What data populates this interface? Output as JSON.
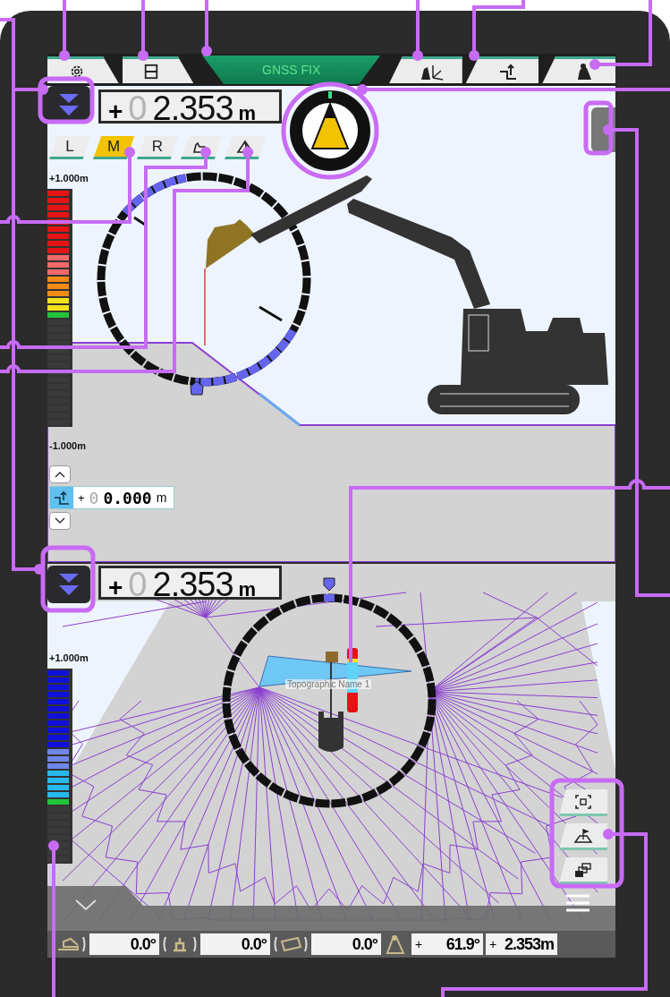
{
  "top_bar": {
    "status": "GNSS FIX"
  },
  "upper_view": {
    "depth": {
      "sign": "+",
      "ghost_digit": "0",
      "value": "2.353",
      "unit": "m"
    },
    "side_tabs": [
      {
        "label": "L",
        "selected": false
      },
      {
        "label": "M",
        "selected": true
      },
      {
        "label": "R",
        "selected": false
      }
    ],
    "scale": {
      "top": "+1.000m",
      "bottom": "-1.000m"
    },
    "offset": {
      "sign": "+",
      "ghost_digit": "0",
      "value": "0.000",
      "unit": "m"
    }
  },
  "lower_view": {
    "depth": {
      "sign": "+",
      "ghost_digit": "0",
      "value": "2.353",
      "unit": "m"
    },
    "scale": {
      "top": "+1.000m"
    },
    "surface_label": "Topographic Name 1"
  },
  "bottom_bar": {
    "angles": [
      {
        "kind": "swing",
        "value": "0.0°"
      },
      {
        "kind": "pitch",
        "value": "0.0°"
      },
      {
        "kind": "tilt",
        "value": "0.0°"
      }
    ],
    "boom": {
      "sign": "+",
      "value": "61.9°"
    },
    "depth": {
      "sign": "+",
      "value": "2.353m"
    }
  }
}
